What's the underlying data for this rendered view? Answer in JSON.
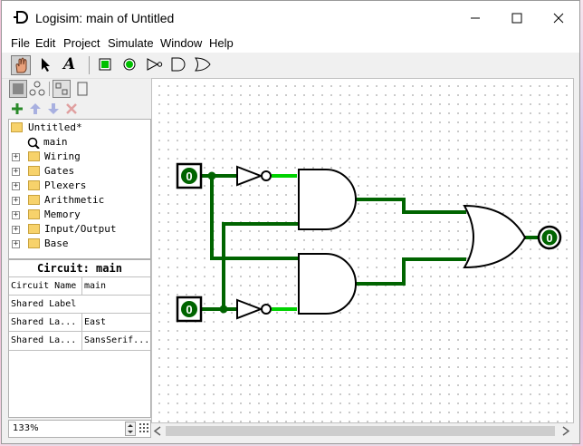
{
  "window": {
    "title": "Logisim: main of Untitled"
  },
  "menu": [
    "File",
    "Edit",
    "Project",
    "Simulate",
    "Window",
    "Help"
  ],
  "toolbar": {
    "tools": [
      "poke-tool",
      "select-tool",
      "text-tool",
      "input-pin",
      "output-pin",
      "not-gate",
      "and-gate",
      "or-gate"
    ],
    "text_tool_glyph": "A"
  },
  "explorer": {
    "root": "Untitled*",
    "main": "main",
    "libraries": [
      "Wiring",
      "Gates",
      "Plexers",
      "Arithmetic",
      "Memory",
      "Input/Output",
      "Base"
    ]
  },
  "attributes": {
    "title": "Circuit: main",
    "rows": [
      {
        "key": "Circuit Name",
        "value": "main"
      },
      {
        "key": "Shared Label",
        "value": ""
      },
      {
        "key": "Shared La...",
        "value": "East"
      },
      {
        "key": "Shared La...",
        "value": "SansSerif..."
      }
    ]
  },
  "zoom": "133%",
  "circuit": {
    "input_a": "0",
    "input_b": "0",
    "output": "0"
  },
  "colors": {
    "wire_dark": "#006400",
    "wire_light": "#00d200",
    "folder": "#f7d26b"
  }
}
